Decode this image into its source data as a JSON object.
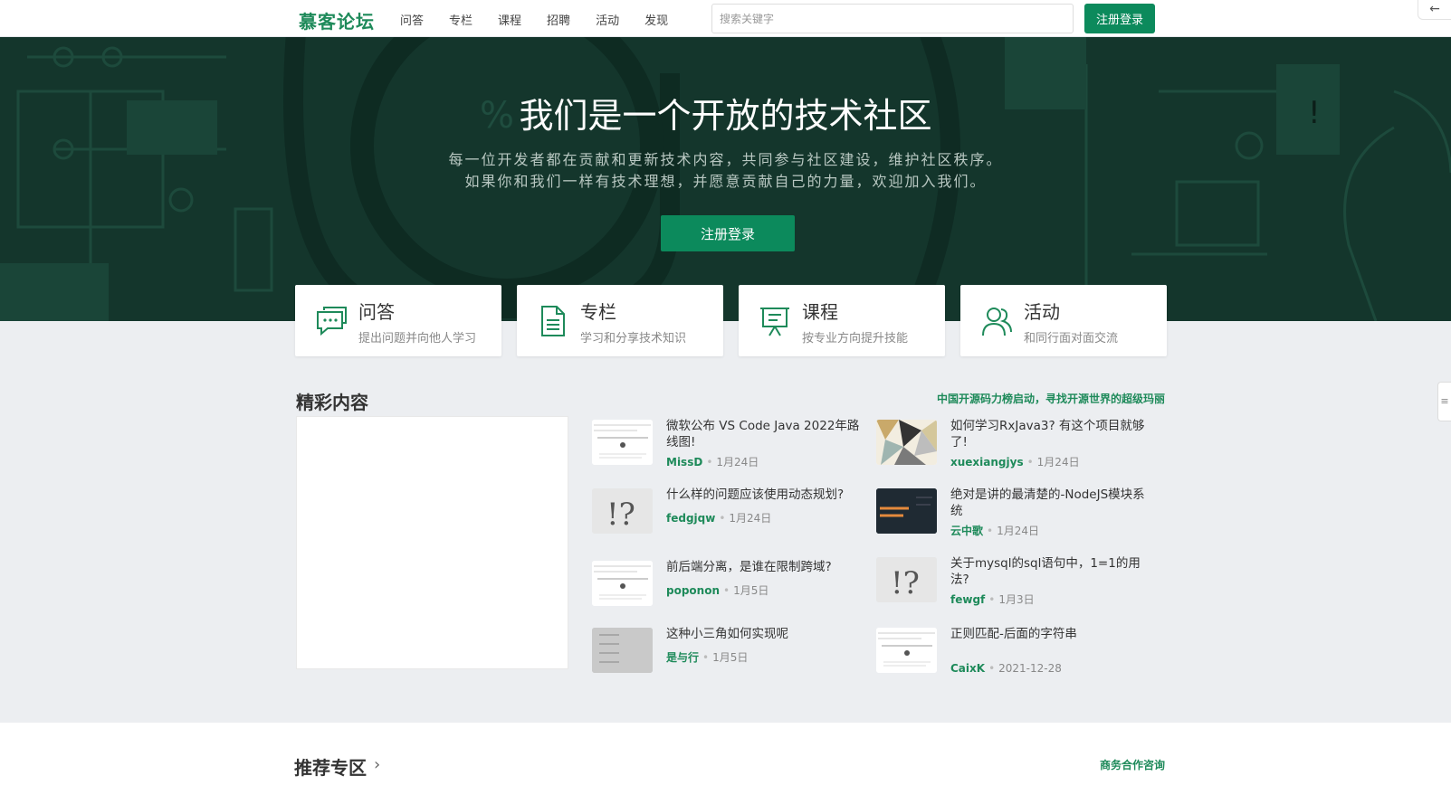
{
  "nav": {
    "logo": "慕客论坛",
    "links": [
      "问答",
      "专栏",
      "课程",
      "招聘",
      "活动",
      "发现"
    ],
    "search_placeholder": "搜索关键字",
    "login_button": "注册登录",
    "back_glyph": "←"
  },
  "hero": {
    "title": "我们是一个开放的技术社区",
    "subtitle_line1": "每一位开发者都在贡献和更新技术内容，共同参与社区建设，维护社区秩序。",
    "subtitle_line2": "如果你和我们一样有技术理想，并愿意贡献自己的力量，欢迎加入我们。",
    "cta": "注册登录"
  },
  "features": [
    {
      "title": "问答",
      "desc": "提出问题并向他人学习",
      "icon": "chat-icon"
    },
    {
      "title": "专栏",
      "desc": "学习和分享技术知识",
      "icon": "document-icon"
    },
    {
      "title": "课程",
      "desc": "按专业方向提升技能",
      "icon": "presentation-icon"
    },
    {
      "title": "活动",
      "desc": "和同行面对面交流",
      "icon": "users-icon"
    }
  ],
  "featured": {
    "title": "精彩内容",
    "promo_link": "中国开源码力榜启动，寻找开源世界的超级玛丽",
    "items": [
      {
        "title": "微软公布 VS Code Java 2022年路线图!",
        "author": "MissD",
        "date": "1月24日",
        "thumb": "screenshot"
      },
      {
        "title": "如何学习RxJava3? 有这个项目就够了!",
        "author": "xuexiangjys",
        "date": "1月24日",
        "thumb": "triangles"
      },
      {
        "title": "什么样的问题应该使用动态规划?",
        "author": "fedgjqw",
        "date": "1月24日",
        "thumb": "question-marks"
      },
      {
        "title": "绝对是讲的最清楚的-NodeJS模块系统",
        "author": "云中歌",
        "date": "1月24日",
        "thumb": "dark-slide"
      },
      {
        "title": "前后端分离，是谁在限制跨域?",
        "author": "poponon",
        "date": "1月5日",
        "thumb": "screenshot"
      },
      {
        "title": "关于mysql的sql语句中，1=1的用法?",
        "author": "fewgf",
        "date": "1月3日",
        "thumb": "question-marks"
      },
      {
        "title": "这种小三角如何实现呢",
        "author": "是与行",
        "date": "1月5日",
        "thumb": "gray-menu"
      },
      {
        "title": "正则匹配-后面的字符串",
        "author": "CaixK",
        "date": "2021-12-28",
        "thumb": "screenshot"
      }
    ]
  },
  "recommended": {
    "title": "推荐专区",
    "chevron": "›",
    "business_link": "商务合作咨询"
  },
  "side_handle_glyph": "≡",
  "colors": {
    "brand": "#0c8a5c",
    "hero_bg": "#14362c"
  }
}
